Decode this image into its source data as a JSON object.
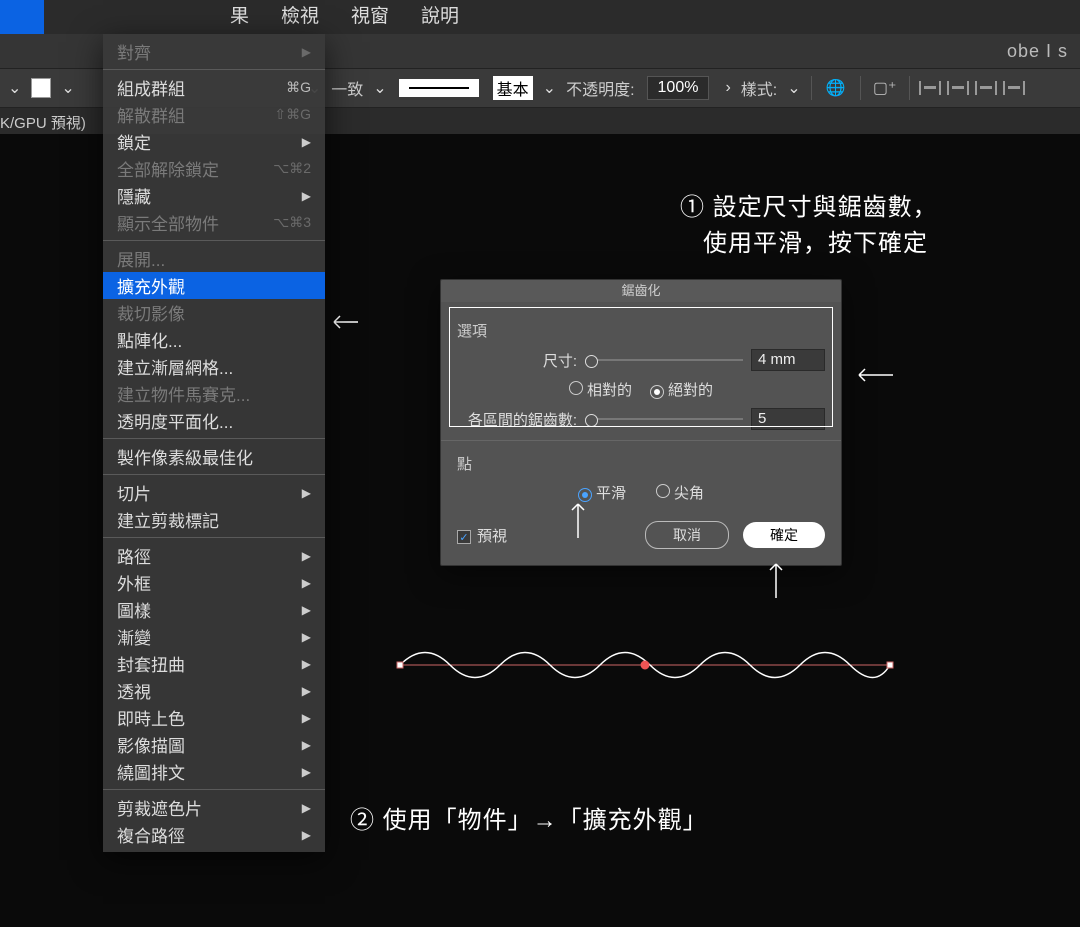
{
  "menubar": {
    "items": [
      "果",
      "檢視",
      "視窗",
      "說明"
    ],
    "active_placeholder": ""
  },
  "titlebar": {
    "brand": "obe I s"
  },
  "optbar": {
    "uniform": "一致",
    "basic": "基本",
    "opacity_label": "不透明度:",
    "opacity_value": "100%",
    "style_label": "樣式:"
  },
  "docbar": {
    "text": "K/GPU 預視)"
  },
  "objmenu": {
    "items": [
      {
        "label": "對齊",
        "sub": true,
        "disabled": true
      },
      {
        "sep": true
      },
      {
        "label": "組成群組",
        "shortcut": "⌘G"
      },
      {
        "label": "解散群組",
        "shortcut": "⇧⌘G",
        "disabled": true
      },
      {
        "label": "鎖定",
        "sub": true
      },
      {
        "label": "全部解除鎖定",
        "shortcut": "⌥⌘2",
        "disabled": true
      },
      {
        "label": "隱藏",
        "sub": true
      },
      {
        "label": "顯示全部物件",
        "shortcut": "⌥⌘3",
        "disabled": true
      },
      {
        "sep": true
      },
      {
        "label": "展開...",
        "disabled": true
      },
      {
        "label": "擴充外觀",
        "hl": true
      },
      {
        "label": "裁切影像",
        "disabled": true
      },
      {
        "label": "點陣化..."
      },
      {
        "label": "建立漸層網格..."
      },
      {
        "label": "建立物件馬賽克...",
        "disabled": true
      },
      {
        "label": "透明度平面化..."
      },
      {
        "sep": true
      },
      {
        "label": "製作像素級最佳化"
      },
      {
        "sep": true
      },
      {
        "label": "切片",
        "sub": true
      },
      {
        "label": "建立剪裁標記"
      },
      {
        "sep": true
      },
      {
        "label": "路徑",
        "sub": true
      },
      {
        "label": "外框",
        "sub": true
      },
      {
        "label": "圖樣",
        "sub": true
      },
      {
        "label": "漸變",
        "sub": true
      },
      {
        "label": "封套扭曲",
        "sub": true
      },
      {
        "label": "透視",
        "sub": true
      },
      {
        "label": "即時上色",
        "sub": true
      },
      {
        "label": "影像描圖",
        "sub": true
      },
      {
        "label": "繞圖排文",
        "sub": true
      },
      {
        "sep": true
      },
      {
        "label": "剪裁遮色片",
        "sub": true
      },
      {
        "label": "複合路徑",
        "sub": true
      }
    ]
  },
  "instructions": {
    "step1_num": "①",
    "step1_a": "設定尺寸與鋸齒數，",
    "step1_b": "使用平滑，按下確定",
    "step2_num": "②",
    "step2": "使用「物件」→「擴充外觀」"
  },
  "dialog": {
    "title": "鋸齒化",
    "section_options": "選項",
    "size_label": "尺寸:",
    "size_value": "4 mm",
    "relative": "相對的",
    "absolute": "絕對的",
    "ridges_label": "各區間的鋸齒數:",
    "ridges_value": "5",
    "section_points": "點",
    "smooth": "平滑",
    "corner": "尖角",
    "preview": "預視",
    "cancel": "取消",
    "ok": "確定"
  }
}
